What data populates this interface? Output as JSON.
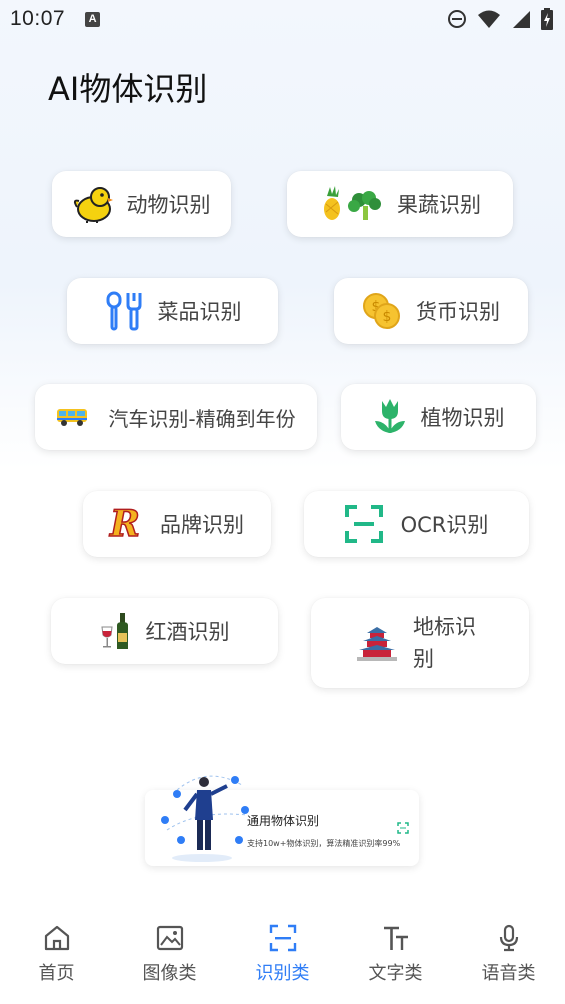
{
  "status": {
    "time": "10:07",
    "notification_icon": "A"
  },
  "page_title": "AI物体识别",
  "cards": [
    {
      "label": "动物识别",
      "icon": "chick-icon"
    },
    {
      "label": "果蔬识别",
      "icon": "fruit-veg-icon"
    },
    {
      "label": "菜品识别",
      "icon": "utensils-icon"
    },
    {
      "label": "货币识别",
      "icon": "coins-icon"
    },
    {
      "label": "汽车识别-精确到年份",
      "icon": "bus-icon"
    },
    {
      "label": "植物识别",
      "icon": "tulip-icon"
    },
    {
      "label": "品牌识别",
      "icon": "brand-r-icon"
    },
    {
      "label": "OCR识别",
      "icon": "scan-text-icon"
    },
    {
      "label": "红酒识别",
      "icon": "wine-icon"
    },
    {
      "label": "地标识别",
      "icon": "temple-icon"
    }
  ],
  "brand_letter": "R",
  "banner": {
    "title": "通用物体识别",
    "subtitle": "支持10w+物体识别，算法精准识别率99%"
  },
  "tabs": [
    {
      "label": "首页",
      "icon": "home-icon",
      "active": false
    },
    {
      "label": "图像类",
      "icon": "image-icon",
      "active": false
    },
    {
      "label": "识别类",
      "icon": "scan-icon",
      "active": true
    },
    {
      "label": "文字类",
      "icon": "text-icon",
      "active": false
    },
    {
      "label": "语音类",
      "icon": "mic-icon",
      "active": false
    }
  ],
  "colors": {
    "accent": "#2f7df6",
    "ocr_green": "#21b888",
    "plant_green": "#2db36a"
  }
}
